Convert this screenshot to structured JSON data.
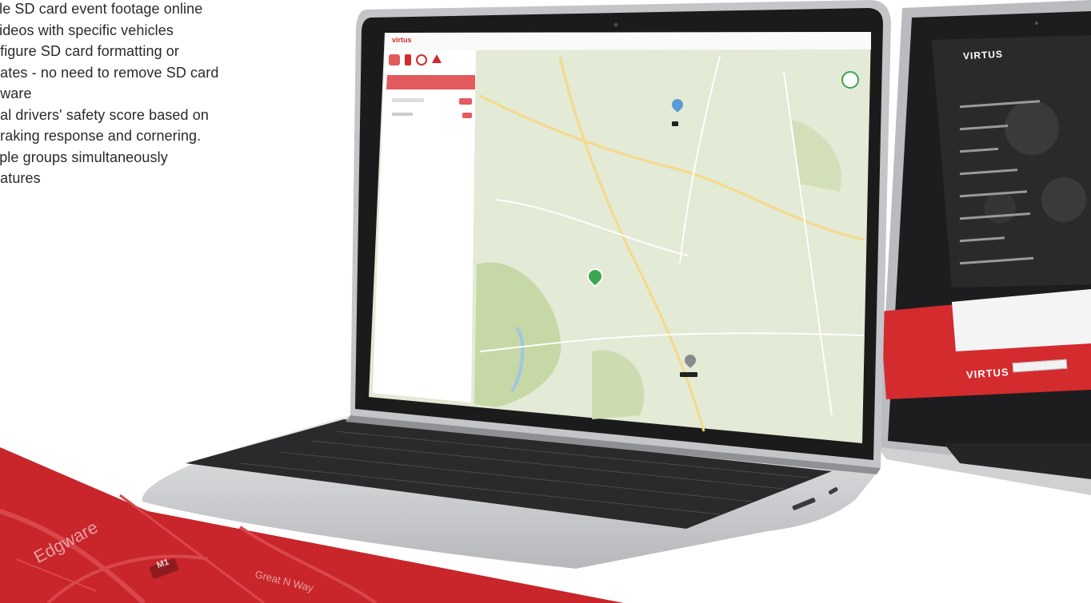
{
  "features": [
    "cle SD card event footage online",
    " videos with specific vehicles",
    "nfigure SD card formatting or",
    "dates - no need to remove SD card",
    "ftware",
    "ual drivers' safety score based on",
    "braking response and cornering.",
    "tiple groups simultaneously",
    "eatures"
  ],
  "map_labels": {
    "edgware": "Edgware",
    "m1": "M1",
    "great_n_way": "Great N Way"
  },
  "colors": {
    "brand_red": "#d42b2f",
    "ribbon_red": "#c8262b",
    "laptop_silver": "#c9cbce",
    "map_green": "#dfe8c9"
  },
  "left_laptop": {
    "app": {
      "logo": "virtus",
      "pins": [
        "blue-marker",
        "green-marker",
        "grey-marker"
      ]
    }
  },
  "right_laptop": {
    "logo": "VIRTUS",
    "footer_logo": "VIRTUS"
  }
}
